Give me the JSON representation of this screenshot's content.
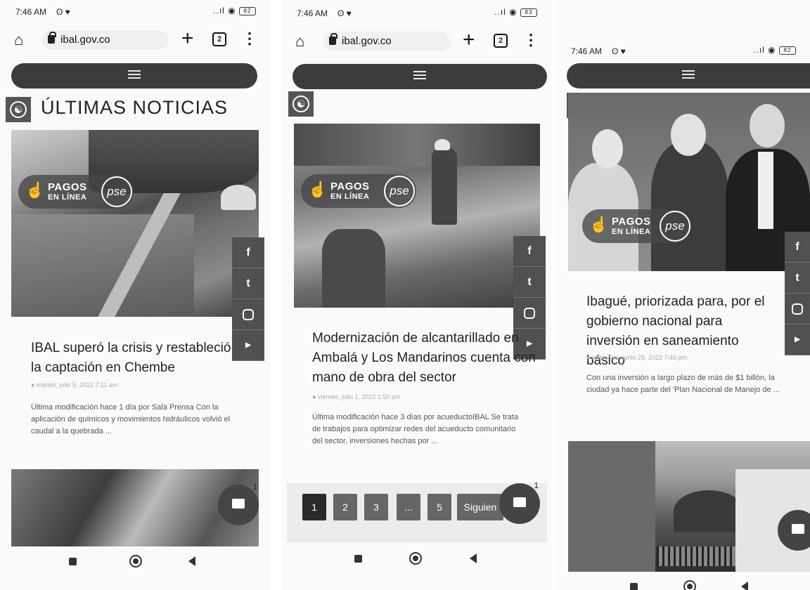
{
  "status": {
    "time": "7:46 AM",
    "time_icons": "ʘ ♥",
    "signal": "..ıl ◉",
    "battery1": "82",
    "battery2": "83",
    "battery3": "82"
  },
  "browser": {
    "url": "ibal.gov.co",
    "tab_count": "2",
    "plus": "+",
    "menu": "⋮",
    "home": "⌂"
  },
  "section_title": "ÚLTIMAS NOTICIAS",
  "pagos": {
    "line1": "PAGOS",
    "line2": "EN LÍNEA",
    "pse": "pse",
    "hand": "☝"
  },
  "social": {
    "facebook": "f",
    "twitter": "t",
    "youtube": "▶"
  },
  "articles": [
    {
      "headline": "IBAL superó la crisis y restableció la captación en Chembe",
      "meta": "● martes, julio 5, 2022 7:11 am",
      "excerpt": "Última modificación hace 1 día por Sala Prensa Con la aplicación de químicos y movimientos hidráulicos volvió el caudal a la quebrada ..."
    },
    {
      "headline": "Modernización de alcantarillado en Ambalá y Los Mandarinos cuenta con mano de obra del sector",
      "meta": "● viernes, julio 1, 2022 1:50 pm",
      "excerpt": "Última modificación hace 3 días por acueductoIBAL Se trata de trabajos para optimizar redes del acueducto comunitario del sector, inversiones hechas por ..."
    },
    {
      "headline": "Ibagué, priorizada para, por el gobierno nacional para inversión en saneamiento básico",
      "meta": "● miércoles, junio 29, 2022 7:45 pm",
      "excerpt": "Con una inversión a largo plazo de más de $1 billón, la ciudad ya hace parte del 'Plan Nacional de Manejo de ..."
    }
  ],
  "pagination": {
    "pages": [
      "1",
      "2",
      "3",
      "...",
      "5"
    ],
    "next": "Siguien",
    "active": "1"
  },
  "chat": {
    "badge": "1"
  },
  "icons": {
    "accessibility": "accessibility-icon",
    "chat": "chat-icon",
    "hamburger": "hamburger-menu-icon"
  },
  "colors": {
    "nav_dark": "#3c3c3c",
    "accent_gray": "#555555"
  }
}
